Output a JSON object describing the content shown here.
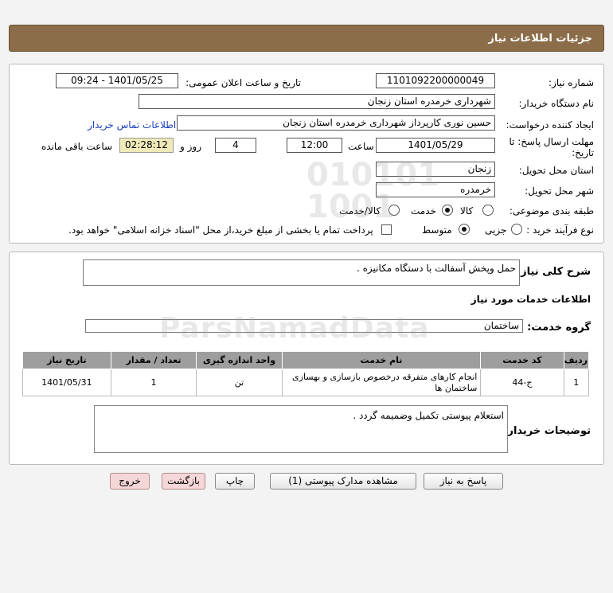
{
  "header": {
    "title": "جزئیات اطلاعات نیاز"
  },
  "form": {
    "need_number_label": "شماره نیاز:",
    "need_number_value": "1101092200000049",
    "announce_label": "تاریخ و ساعت اعلان عمومی:",
    "announce_value": "1401/05/25 - 09:24",
    "buyer_label": "نام دستگاه خریدار:",
    "buyer_value": "شهرداری خرمدره استان زنجان",
    "creator_label": "ایجاد کننده درخواست:",
    "creator_value": "حسین نوری کارپرداز شهرداری خرمدره استان زنجان",
    "contact_link": "اطلاعات تماس خریدار",
    "deadline_label_1": "مهلت ارسال پاسخ: تا",
    "deadline_label_2": "تاریخ:",
    "deadline_date": "1401/05/29",
    "time_label": "ساعت",
    "deadline_time": "12:00",
    "days_value": "4",
    "days_label": "روز و",
    "remaining_value": "02:28:12",
    "remaining_label": "ساعت باقی مانده",
    "province_label": "استان محل تحویل:",
    "province_value": "زنجان",
    "city_label": "شهر محل تحویل:",
    "city_value": "خرمدره",
    "category_label": "طبقه بندی موضوعی:",
    "category_options": [
      "کالا",
      "خدمت",
      "کالا/خدمت"
    ],
    "category_selected": "خدمت",
    "process_label": "نوع فرآیند خرید :",
    "process_options": [
      "جزیی",
      "متوسط"
    ],
    "process_selected": "متوسط",
    "payment_note": "پرداخت تمام یا بخشی از مبلغ خرید،از محل \"اسناد خزانه اسلامی\" خواهد بود."
  },
  "details": {
    "summary_label": "شرح کلی نیاز:",
    "summary_value": "حمل وپخش آسفالت با دستگاه مکانیزه .",
    "services_heading": "اطلاعات خدمات مورد نیاز",
    "service_group_label": "گروه خدمت:",
    "service_group_value": "ساختمان",
    "table": {
      "columns": [
        "ردیف",
        "کد خدمت",
        "نام خدمت",
        "واحد اندازه گیری",
        "تعداد / مقدار",
        "تاریخ نیاز"
      ],
      "rows": [
        [
          "1",
          "ج-44",
          "انجام کارهای متفرقه درخصوص بازسازی و بهسازی ساختمان ها",
          "تن",
          "1",
          "1401/05/31"
        ]
      ]
    },
    "buyer_notes_label": "توضیحات خریدار:",
    "buyer_notes_value": "استعلام پیوستی تکمیل وضمیمه گردد ."
  },
  "buttons": {
    "reply": "پاسخ به نیاز",
    "view_docs": "مشاهده مدارک پیوستی (1)",
    "print": "چاپ",
    "back": "بازگشت",
    "exit": "خروج"
  },
  "colors": {
    "header_bg": "#8b6d4a",
    "remaining_bg": "#f0e9b8",
    "table_head_bg": "#9e9e9e",
    "link": "#1a3fbf",
    "danger_btn_bg": "#f5d7d7"
  }
}
